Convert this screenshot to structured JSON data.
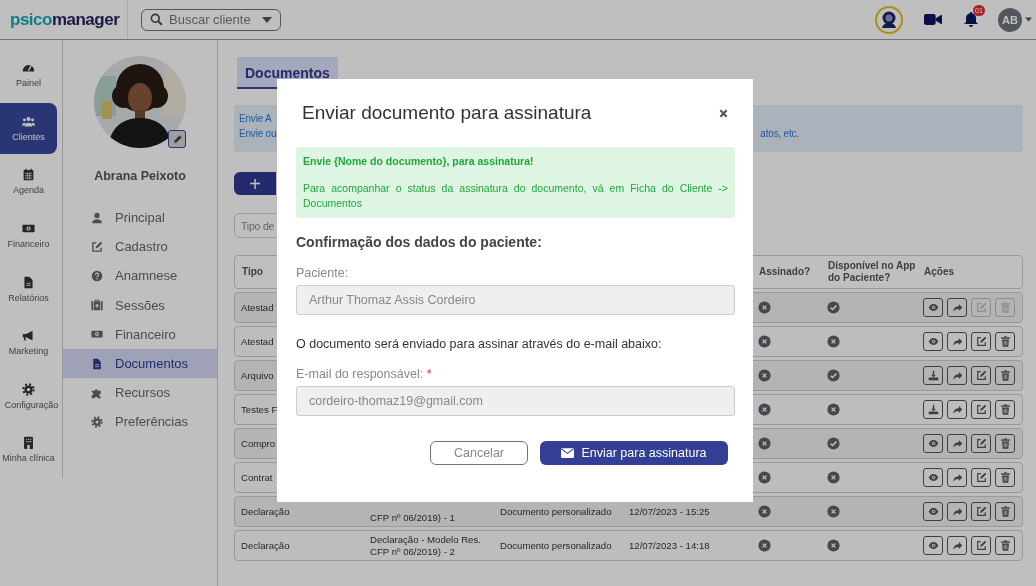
{
  "topbar": {
    "logo": [
      "psico",
      "manager"
    ],
    "search": {
      "placeholder": "Buscar cliente"
    },
    "notifications": "01",
    "user_initials": "AB"
  },
  "rail": {
    "items": [
      {
        "label": "Painel",
        "selected": false
      },
      {
        "label": "Clientes",
        "selected": true
      },
      {
        "label": "Agenda",
        "selected": false
      },
      {
        "label": "Financeiro",
        "selected": false
      },
      {
        "label": "Relatórios",
        "selected": false
      },
      {
        "label": "Marketing",
        "selected": false
      },
      {
        "label": "Configuração",
        "selected": false
      },
      {
        "label": "Minha clínica",
        "selected": false
      }
    ]
  },
  "profile": {
    "name": "Abrana Peixoto",
    "menu": [
      {
        "label": "Principal",
        "selected": false
      },
      {
        "label": "Cadastro",
        "selected": false
      },
      {
        "label": "Anamnese",
        "selected": false
      },
      {
        "label": "Sessões",
        "selected": false
      },
      {
        "label": "Financeiro",
        "selected": false
      },
      {
        "label": "Documentos",
        "selected": true
      },
      {
        "label": "Recursos",
        "selected": false
      },
      {
        "label": "Preferências",
        "selected": false
      }
    ]
  },
  "page": {
    "tab": "Documentos",
    "info": {
      "line_1_start": "Envie A",
      "line_2_start": "Envie ou",
      "line_2_end": "atos, etc."
    },
    "add_button": "+",
    "filter": {
      "placeholder": "Tipo de"
    }
  },
  "table": {
    "columns": [
      {
        "kind": "type",
        "label": "Tipo"
      },
      {
        "kind": "signed",
        "label": "Assinado?"
      },
      {
        "kind": "available",
        "label": "Disponível no App do Paciente?"
      },
      {
        "kind": "actions",
        "label": "Ações"
      }
    ],
    "rows": [
      {
        "type": "Atestad",
        "signed": false,
        "available": true,
        "actions": [
          {
            "kind": "view",
            "disabled": false
          },
          {
            "kind": "share",
            "disabled": false
          },
          {
            "kind": "edit",
            "disabled": true
          },
          {
            "kind": "delete",
            "disabled": true
          }
        ]
      },
      {
        "type": "Atestad",
        "signed": false,
        "available": false,
        "actions": [
          {
            "kind": "view",
            "disabled": false
          },
          {
            "kind": "share",
            "disabled": false
          },
          {
            "kind": "edit",
            "disabled": false
          },
          {
            "kind": "delete",
            "disabled": false
          }
        ]
      },
      {
        "type": "Arquivo",
        "signed": false,
        "available": true,
        "actions": [
          {
            "kind": "download",
            "disabled": false
          },
          {
            "kind": "share",
            "disabled": false
          },
          {
            "kind": "edit",
            "disabled": false
          },
          {
            "kind": "delete",
            "disabled": false
          }
        ]
      },
      {
        "type": "Testes F",
        "signed": false,
        "available": false,
        "actions": [
          {
            "kind": "download",
            "disabled": false
          },
          {
            "kind": "share",
            "disabled": false
          },
          {
            "kind": "edit",
            "disabled": false
          },
          {
            "kind": "delete",
            "disabled": false
          }
        ]
      },
      {
        "type": "Compro",
        "signed": false,
        "available": true,
        "actions": [
          {
            "kind": "view",
            "disabled": false
          },
          {
            "kind": "share",
            "disabled": false
          },
          {
            "kind": "edit",
            "disabled": false
          },
          {
            "kind": "delete",
            "disabled": false
          }
        ]
      },
      {
        "type": "Contrat",
        "signed": false,
        "available": false,
        "actions": [
          {
            "kind": "view",
            "disabled": false
          },
          {
            "kind": "share",
            "disabled": false
          },
          {
            "kind": "edit",
            "disabled": false
          },
          {
            "kind": "delete",
            "disabled": false
          }
        ]
      },
      {
        "type": "Declaração",
        "name": "CFP nº 06/2019) - 1",
        "category": "Documento personalizado",
        "date": "12/07/2023 - 15:25",
        "signed": false,
        "available": false,
        "actions": [
          {
            "kind": "view",
            "disabled": false
          },
          {
            "kind": "share",
            "disabled": false
          },
          {
            "kind": "edit",
            "disabled": false
          },
          {
            "kind": "delete",
            "disabled": false
          }
        ]
      },
      {
        "type": "Declaração",
        "name": "Declaração - Modelo Res. CFP nº 06/2019) - 2",
        "category": "Documento personalizado",
        "date": "12/07/2023 - 14:18",
        "signed": false,
        "available": false,
        "actions": [
          {
            "kind": "view",
            "disabled": false
          },
          {
            "kind": "share",
            "disabled": false
          },
          {
            "kind": "edit",
            "disabled": false
          },
          {
            "kind": "delete",
            "disabled": false
          }
        ]
      }
    ]
  },
  "modal": {
    "title": "Enviar documento para assinatura",
    "alert": {
      "heading": "Envie {Nome do documento}, para assinatura!",
      "text": "Para acompanhar o status da assinatura do documento, vá em Ficha do Cliente -> Documentos"
    },
    "section_title": "Confirmação dos dados do paciente:",
    "patient": {
      "label": "Paciente:",
      "value": "Arthur Thomaz Assis Cordeiro",
      "disabled": true
    },
    "note": "O documento será enviado para assinar através do e-mail abaixo:",
    "email": {
      "label": "E-mail do responsável:",
      "required_mark": "*",
      "value": "cordeiro-thomaz19@gmail.com",
      "disabled": true
    },
    "cancel": "Cancelar",
    "submit": "Enviar para assinatura"
  }
}
